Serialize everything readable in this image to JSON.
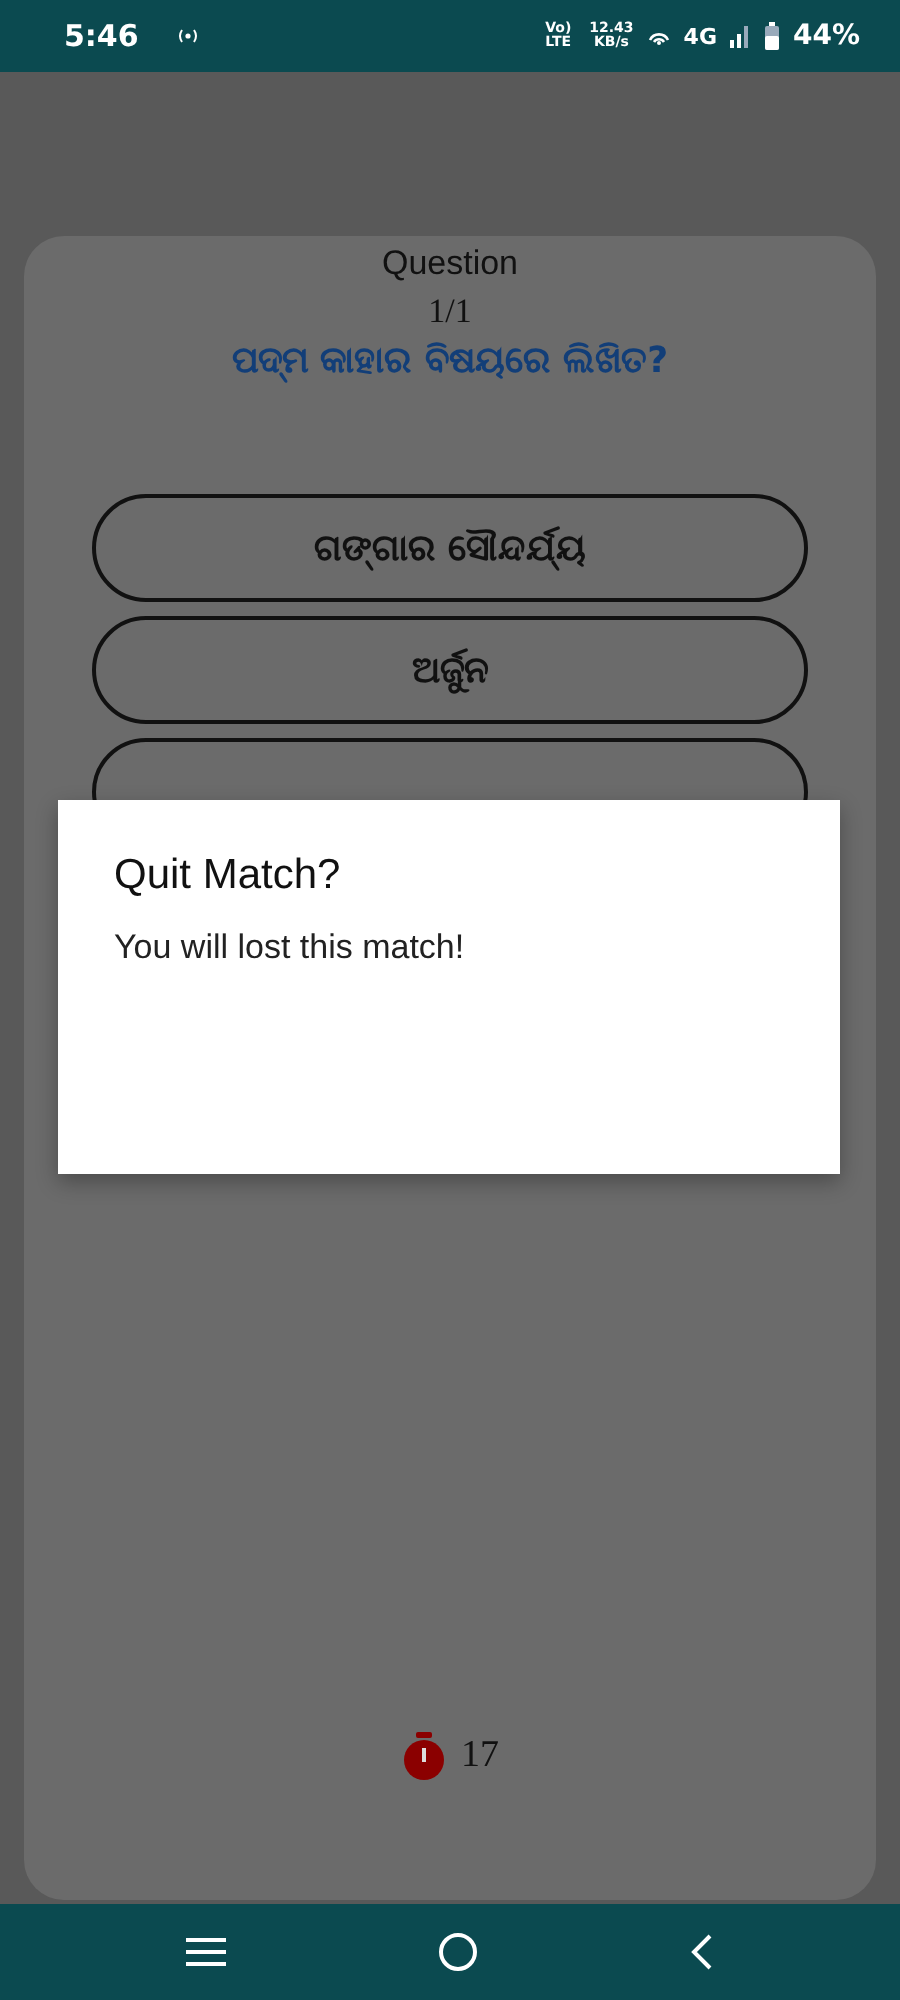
{
  "status_bar": {
    "time": "5:46",
    "network_speed": "12.43",
    "network_unit": "KB/s",
    "volte": "Vo) LTE",
    "network_type": "4G",
    "battery": "44%"
  },
  "quiz": {
    "heading": "Question",
    "progress": "1/1",
    "question": "ପଦ୍ମ କାହାର ବିଷୟରେ ଲିଖିତ?",
    "options": [
      {
        "kind": "labeled",
        "label": "ଗଙ୍ଗାର ସୌନ୍ଦର୍ଯ୍ୟ"
      },
      {
        "kind": "labeled",
        "label": "ଅର୍ଜୁନ"
      },
      {
        "kind": "covered"
      }
    ],
    "timer": "17"
  },
  "dialog": {
    "title": "Quit Match?",
    "message": "You will lost this match!"
  }
}
